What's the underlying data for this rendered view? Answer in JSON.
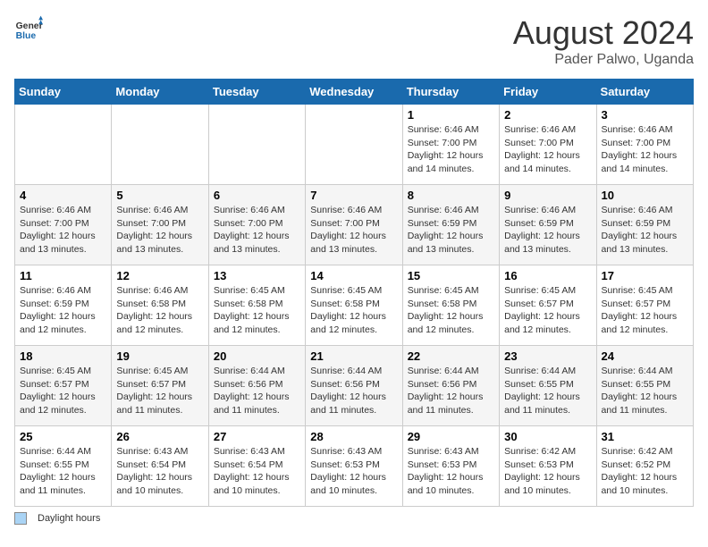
{
  "header": {
    "logo_general": "General",
    "logo_blue": "Blue",
    "title": "August 2024",
    "subtitle": "Pader Palwo, Uganda"
  },
  "days_of_week": [
    "Sunday",
    "Monday",
    "Tuesday",
    "Wednesday",
    "Thursday",
    "Friday",
    "Saturday"
  ],
  "footer": {
    "daylight_label": "Daylight hours"
  },
  "weeks": [
    {
      "days": [
        {
          "num": "",
          "info": ""
        },
        {
          "num": "",
          "info": ""
        },
        {
          "num": "",
          "info": ""
        },
        {
          "num": "",
          "info": ""
        },
        {
          "num": "1",
          "info": "Sunrise: 6:46 AM\nSunset: 7:00 PM\nDaylight: 12 hours\nand 14 minutes."
        },
        {
          "num": "2",
          "info": "Sunrise: 6:46 AM\nSunset: 7:00 PM\nDaylight: 12 hours\nand 14 minutes."
        },
        {
          "num": "3",
          "info": "Sunrise: 6:46 AM\nSunset: 7:00 PM\nDaylight: 12 hours\nand 14 minutes."
        }
      ]
    },
    {
      "days": [
        {
          "num": "4",
          "info": "Sunrise: 6:46 AM\nSunset: 7:00 PM\nDaylight: 12 hours\nand 13 minutes."
        },
        {
          "num": "5",
          "info": "Sunrise: 6:46 AM\nSunset: 7:00 PM\nDaylight: 12 hours\nand 13 minutes."
        },
        {
          "num": "6",
          "info": "Sunrise: 6:46 AM\nSunset: 7:00 PM\nDaylight: 12 hours\nand 13 minutes."
        },
        {
          "num": "7",
          "info": "Sunrise: 6:46 AM\nSunset: 7:00 PM\nDaylight: 12 hours\nand 13 minutes."
        },
        {
          "num": "8",
          "info": "Sunrise: 6:46 AM\nSunset: 6:59 PM\nDaylight: 12 hours\nand 13 minutes."
        },
        {
          "num": "9",
          "info": "Sunrise: 6:46 AM\nSunset: 6:59 PM\nDaylight: 12 hours\nand 13 minutes."
        },
        {
          "num": "10",
          "info": "Sunrise: 6:46 AM\nSunset: 6:59 PM\nDaylight: 12 hours\nand 13 minutes."
        }
      ]
    },
    {
      "days": [
        {
          "num": "11",
          "info": "Sunrise: 6:46 AM\nSunset: 6:59 PM\nDaylight: 12 hours\nand 12 minutes."
        },
        {
          "num": "12",
          "info": "Sunrise: 6:46 AM\nSunset: 6:58 PM\nDaylight: 12 hours\nand 12 minutes."
        },
        {
          "num": "13",
          "info": "Sunrise: 6:45 AM\nSunset: 6:58 PM\nDaylight: 12 hours\nand 12 minutes."
        },
        {
          "num": "14",
          "info": "Sunrise: 6:45 AM\nSunset: 6:58 PM\nDaylight: 12 hours\nand 12 minutes."
        },
        {
          "num": "15",
          "info": "Sunrise: 6:45 AM\nSunset: 6:58 PM\nDaylight: 12 hours\nand 12 minutes."
        },
        {
          "num": "16",
          "info": "Sunrise: 6:45 AM\nSunset: 6:57 PM\nDaylight: 12 hours\nand 12 minutes."
        },
        {
          "num": "17",
          "info": "Sunrise: 6:45 AM\nSunset: 6:57 PM\nDaylight: 12 hours\nand 12 minutes."
        }
      ]
    },
    {
      "days": [
        {
          "num": "18",
          "info": "Sunrise: 6:45 AM\nSunset: 6:57 PM\nDaylight: 12 hours\nand 12 minutes."
        },
        {
          "num": "19",
          "info": "Sunrise: 6:45 AM\nSunset: 6:57 PM\nDaylight: 12 hours\nand 11 minutes."
        },
        {
          "num": "20",
          "info": "Sunrise: 6:44 AM\nSunset: 6:56 PM\nDaylight: 12 hours\nand 11 minutes."
        },
        {
          "num": "21",
          "info": "Sunrise: 6:44 AM\nSunset: 6:56 PM\nDaylight: 12 hours\nand 11 minutes."
        },
        {
          "num": "22",
          "info": "Sunrise: 6:44 AM\nSunset: 6:56 PM\nDaylight: 12 hours\nand 11 minutes."
        },
        {
          "num": "23",
          "info": "Sunrise: 6:44 AM\nSunset: 6:55 PM\nDaylight: 12 hours\nand 11 minutes."
        },
        {
          "num": "24",
          "info": "Sunrise: 6:44 AM\nSunset: 6:55 PM\nDaylight: 12 hours\nand 11 minutes."
        }
      ]
    },
    {
      "days": [
        {
          "num": "25",
          "info": "Sunrise: 6:44 AM\nSunset: 6:55 PM\nDaylight: 12 hours\nand 11 minutes."
        },
        {
          "num": "26",
          "info": "Sunrise: 6:43 AM\nSunset: 6:54 PM\nDaylight: 12 hours\nand 10 minutes."
        },
        {
          "num": "27",
          "info": "Sunrise: 6:43 AM\nSunset: 6:54 PM\nDaylight: 12 hours\nand 10 minutes."
        },
        {
          "num": "28",
          "info": "Sunrise: 6:43 AM\nSunset: 6:53 PM\nDaylight: 12 hours\nand 10 minutes."
        },
        {
          "num": "29",
          "info": "Sunrise: 6:43 AM\nSunset: 6:53 PM\nDaylight: 12 hours\nand 10 minutes."
        },
        {
          "num": "30",
          "info": "Sunrise: 6:42 AM\nSunset: 6:53 PM\nDaylight: 12 hours\nand 10 minutes."
        },
        {
          "num": "31",
          "info": "Sunrise: 6:42 AM\nSunset: 6:52 PM\nDaylight: 12 hours\nand 10 minutes."
        }
      ]
    }
  ]
}
